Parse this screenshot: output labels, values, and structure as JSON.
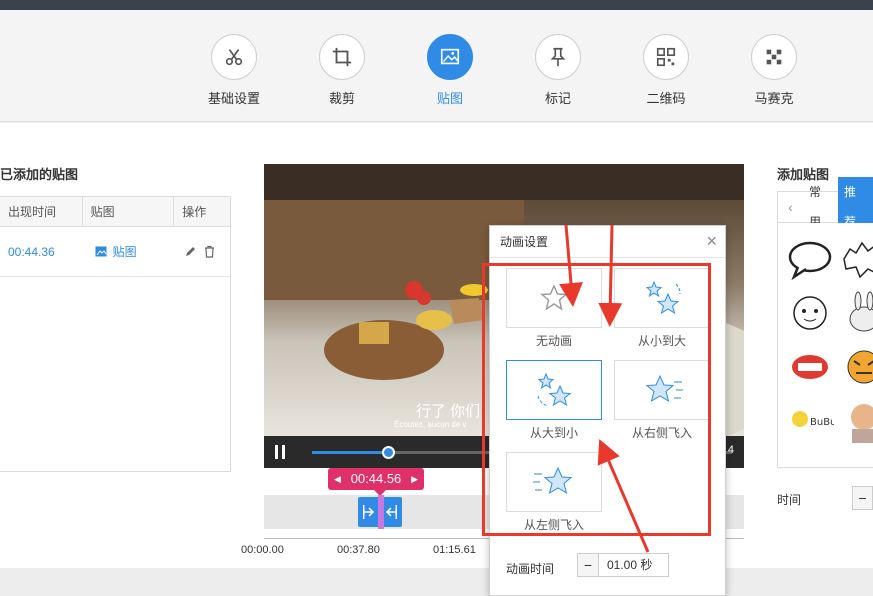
{
  "toolbar": {
    "items": [
      {
        "label": "基础设置",
        "icon": "scissors-icon"
      },
      {
        "label": "裁剪",
        "icon": "crop-icon"
      },
      {
        "label": "贴图",
        "icon": "image-icon",
        "active": true
      },
      {
        "label": "标记",
        "icon": "pin-icon"
      },
      {
        "label": "二维码",
        "icon": "qrcode-icon"
      },
      {
        "label": "马赛克",
        "icon": "mosaic-icon"
      }
    ]
  },
  "stickers_panel": {
    "title": "已添加的贴图",
    "columns": [
      "出现时间",
      "贴图",
      "操作"
    ],
    "rows": [
      {
        "time": "00:44.36",
        "sticker": "贴图"
      }
    ]
  },
  "video": {
    "subtitle": "行了 你们",
    "subtitle_fr": "Écoutez, aucun de v",
    "duration_tail": "4",
    "progress": 0.18
  },
  "timeline": {
    "current_time": "00:44.56",
    "ticks": [
      "00:00.00",
      "00:37.80",
      "01:15.61"
    ]
  },
  "add_sticker": {
    "title": "添加贴图",
    "tabs": [
      "常用",
      "推荐"
    ],
    "active_tab": "推荐",
    "time_label": "时间"
  },
  "dialog": {
    "title": "动画设置",
    "options": [
      {
        "label": "无动画"
      },
      {
        "label": "从小到大"
      },
      {
        "label": "从大到小",
        "selected": true
      },
      {
        "label": "从右侧飞入"
      },
      {
        "label": "从左侧飞入"
      }
    ],
    "duration_label": "动画时间",
    "duration_value": "01.00 秒"
  },
  "colors": {
    "accent": "#2f8be6",
    "annotation": "#e8392c",
    "time_flag": "#e0306a"
  }
}
